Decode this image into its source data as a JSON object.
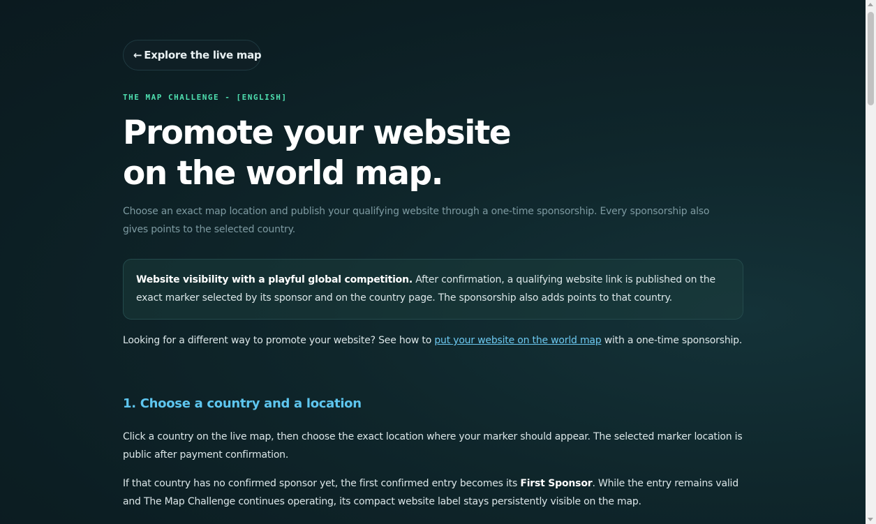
{
  "back_link": {
    "arrow": "←",
    "label": "Explore the live map"
  },
  "eyebrow": "THE MAP CHALLENGE - [ENGLISH]",
  "hero": {
    "title_line1": "Promote your website",
    "title_line2": "on the world map.",
    "lead": "Choose an exact map location and publish your qualifying website through a one-time sponsorship. Every sponsorship also gives points to the selected country."
  },
  "callout": {
    "strong": "Website visibility with a playful global competition.",
    "text": " After confirmation, a qualifying website link is published on the exact marker selected by its sponsor and on the country page. The sponsorship also adds points to that country."
  },
  "alt_promo": {
    "before": "Looking for a different way to promote your website? See how to ",
    "link": "put your website on the world map",
    "after": " with a one-time sponsorship."
  },
  "section1": {
    "heading": "1. Choose a country and a location",
    "para1": "Click a country on the live map, then choose the exact location where your marker should appear. The selected marker location is public after payment confirmation.",
    "para2_before": "If that country has no confirmed sponsor yet, the first confirmed entry becomes its ",
    "para2_strong": "First Sponsor",
    "para2_after": ". While the entry remains valid and The Map Challenge continues operating, its compact website label stays persistently visible on the map."
  },
  "colors": {
    "accent_green": "#4fe0b0",
    "accent_blue": "#5ec6ef",
    "link": "#6cc8f0",
    "background": "#0f262b"
  }
}
